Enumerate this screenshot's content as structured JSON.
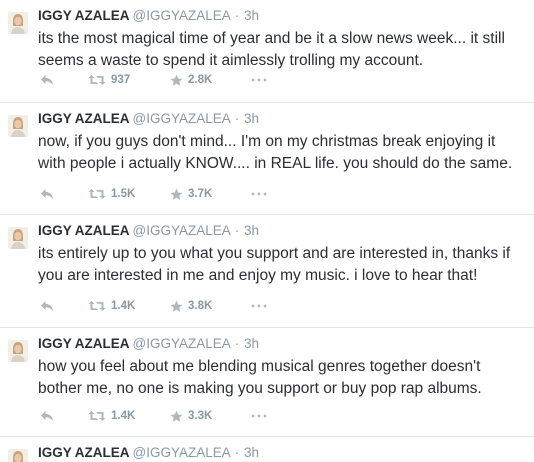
{
  "user": {
    "name": "IGGY AZALEA",
    "handle": "@IGGYAZALEA",
    "separator": "·"
  },
  "tweets": [
    {
      "time": "3h",
      "text": "its the most magical time of year and be it a slow news week... it still seems a waste to spend it aimlessly trolling my account.",
      "retweets": "937",
      "favorites": "2.8K"
    },
    {
      "time": "3h",
      "text": "now, if you guys don't mind... I'm on my christmas break enjoying it with people i actually KNOW.... in REAL life. you should do the same.",
      "retweets": "1.5K",
      "favorites": "3.7K"
    },
    {
      "time": "3h",
      "text": "its entirely up to you what you support and are interested in, thanks if you are interested in me and enjoy my music. i love to hear that!",
      "retweets": "1.4K",
      "favorites": "3.8K"
    },
    {
      "time": "3h",
      "text": "how you feel about me blending musical genres together doesn't bother me, no one is making you support or buy pop rap albums.",
      "retweets": "1.4K",
      "favorites": "3.3K"
    },
    {
      "time": "3h"
    }
  ],
  "icons": {
    "reply": "reply-icon",
    "retweet": "retweet-icon",
    "favorite": "star-icon",
    "more": "more-dots-icon"
  },
  "colors": {
    "text": "#292f33",
    "muted": "#8899a6",
    "divider": "#e1e8ed"
  }
}
